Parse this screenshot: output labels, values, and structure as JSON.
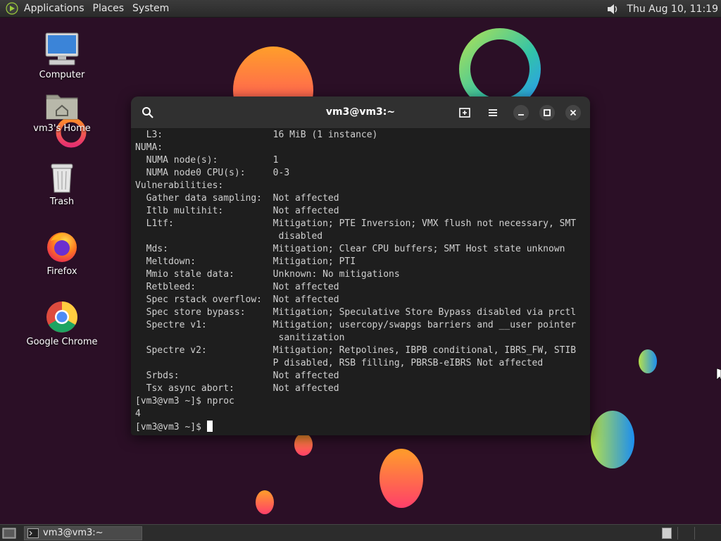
{
  "top_panel": {
    "menus": [
      "Applications",
      "Places",
      "System"
    ],
    "clock": "Thu Aug 10, 11:19"
  },
  "desktop_icons": [
    {
      "label": "Computer",
      "icon": "computer-icon"
    },
    {
      "label": "vm3's Home",
      "icon": "home-folder-icon"
    },
    {
      "label": "Trash",
      "icon": "trash-icon"
    },
    {
      "label": "Firefox",
      "icon": "firefox-icon"
    },
    {
      "label": "Google Chrome",
      "icon": "chrome-icon"
    }
  ],
  "terminal": {
    "title": "vm3@vm3:~",
    "lines": [
      "  L3:                    16 MiB (1 instance)",
      "NUMA:",
      "  NUMA node(s):          1",
      "  NUMA node0 CPU(s):     0-3",
      "Vulnerabilities:",
      "  Gather data sampling:  Not affected",
      "  Itlb multihit:         Not affected",
      "  L1tf:                  Mitigation; PTE Inversion; VMX flush not necessary, SMT",
      "                          disabled",
      "  Mds:                   Mitigation; Clear CPU buffers; SMT Host state unknown",
      "  Meltdown:              Mitigation; PTI",
      "  Mmio stale data:       Unknown: No mitigations",
      "  Retbleed:              Not affected",
      "  Spec rstack overflow:  Not affected",
      "  Spec store bypass:     Mitigation; Speculative Store Bypass disabled via prctl",
      "  Spectre v1:            Mitigation; usercopy/swapgs barriers and __user pointer",
      "                          sanitization",
      "  Spectre v2:            Mitigation; Retpolines, IBPB conditional, IBRS_FW, STIB",
      "                         P disabled, RSB filling, PBRSB-eIBRS Not affected",
      "  Srbds:                 Not affected",
      "  Tsx async abort:       Not affected",
      "[vm3@vm3 ~]$ nproc",
      "4"
    ],
    "prompt": "[vm3@vm3 ~]$ "
  },
  "taskbar": {
    "window_button": "vm3@vm3:~"
  },
  "colors": {
    "wallpaper": "#2b0f26",
    "terminal_bg": "#1e1e1e",
    "terminal_header": "#303030",
    "terminal_text": "#d0d0d0"
  }
}
